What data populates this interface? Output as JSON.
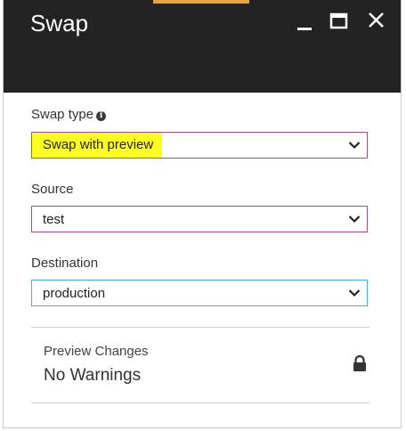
{
  "window": {
    "title": "Swap",
    "accent_color": "#e8a33c",
    "header_color": "#232323"
  },
  "form": {
    "swap_type": {
      "label": "Swap type",
      "info_icon": "info-icon",
      "value": "Swap with preview",
      "highlight_color": "#ffff22"
    },
    "source": {
      "label": "Source",
      "value": "test"
    },
    "destination": {
      "label": "Destination",
      "value": "production"
    }
  },
  "preview": {
    "label": "Preview Changes",
    "status": "No Warnings",
    "icon": "lock-icon"
  }
}
